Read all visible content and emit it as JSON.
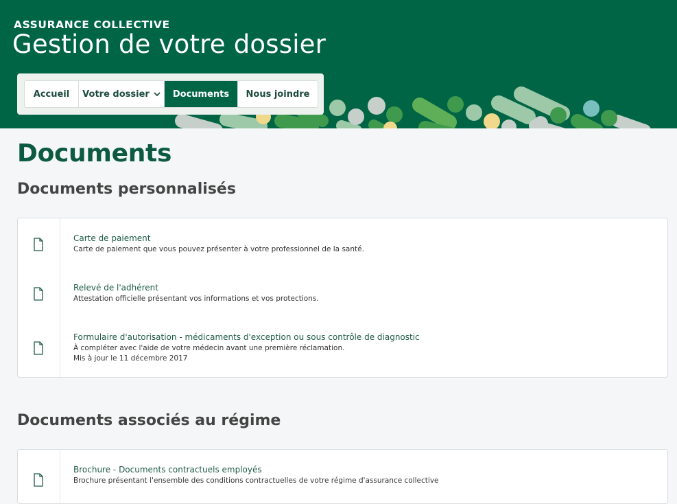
{
  "header": {
    "eyebrow": "ASSURANCE COLLECTIVE",
    "title": "Gestion de votre dossier",
    "bg_color": "#006544"
  },
  "nav": {
    "items": [
      {
        "label": "Accueil"
      },
      {
        "label": "Votre dossier",
        "has_dropdown": true,
        "icon": "chevron-down-icon"
      },
      {
        "label": "Documents",
        "active": true
      },
      {
        "label": "Nous joindre"
      }
    ]
  },
  "page": {
    "title": "Documents",
    "title_color": "#0c5a40"
  },
  "sections": [
    {
      "title": "Documents personnalisés",
      "documents": [
        {
          "icon": "document-icon",
          "title": "Carte de paiement",
          "lines": [
            "Carte de paiement que vous pouvez présenter à votre professionnel de la santé."
          ]
        },
        {
          "icon": "document-icon",
          "title": "Relevé de l'adhérent",
          "lines": [
            "Attestation officielle présentant vos informations et vos protections."
          ]
        },
        {
          "icon": "document-icon",
          "title": "Formulaire d'autorisation - médicaments d'exception ou sous contrôle de diagnostic",
          "lines": [
            "À compléter avec l'aide de votre médecin avant une première réclamation.",
            "Mis à jour le 11 décembre 2017"
          ]
        }
      ]
    },
    {
      "title": "Documents associés au régime",
      "documents": [
        {
          "icon": "document-icon",
          "title": "Brochure - Documents contractuels employés",
          "lines": [
            "Brochure présentant l'ensemble des conditions contractuelles de votre régime d'assurance collective"
          ]
        }
      ]
    }
  ]
}
